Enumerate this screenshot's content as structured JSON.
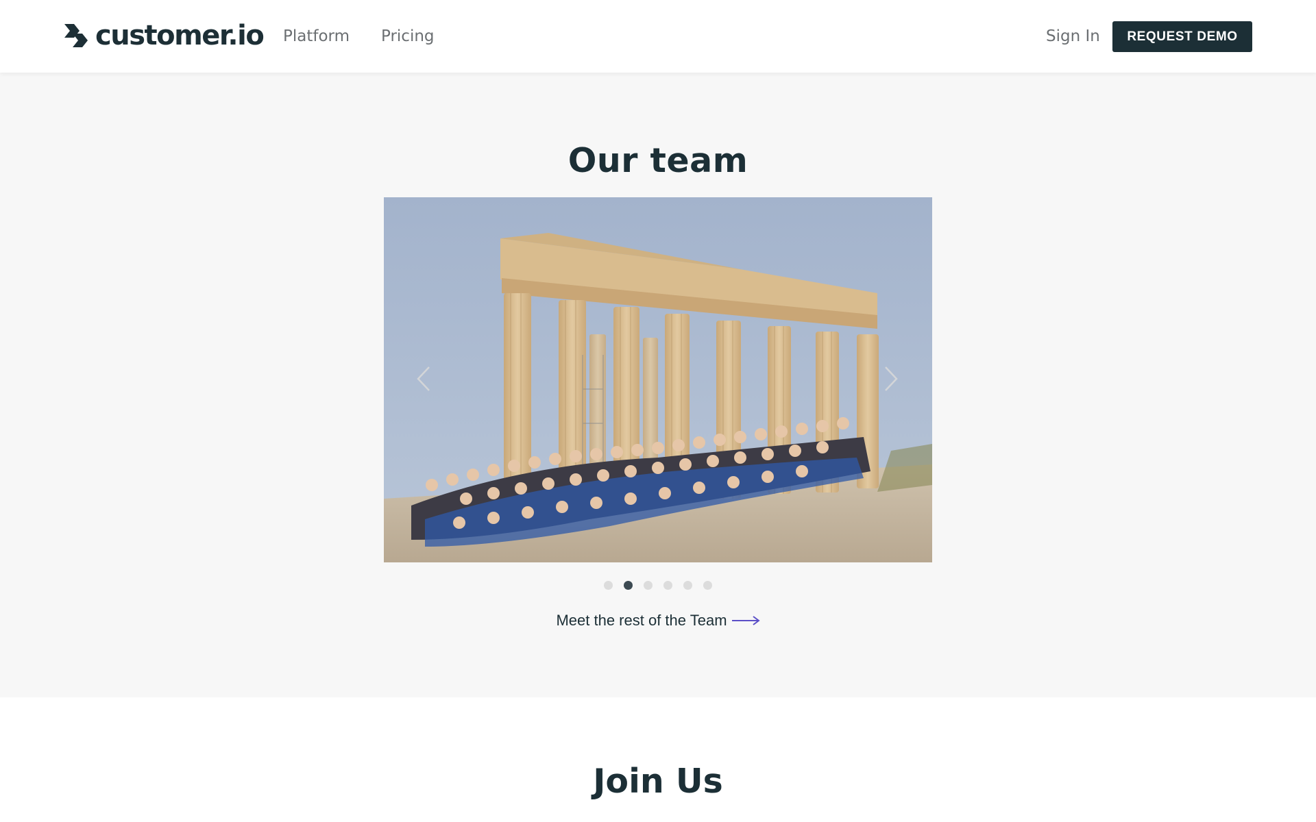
{
  "header": {
    "brand": "customer.io",
    "nav": [
      {
        "label": "Platform"
      },
      {
        "label": "Pricing"
      }
    ],
    "sign_in": "Sign In",
    "request_demo": "REQUEST DEMO"
  },
  "team": {
    "title": "Our team",
    "carousel": {
      "slide_count": 6,
      "active_index": 1
    },
    "meet_link": "Meet the rest of the Team"
  },
  "join": {
    "title": "Join Us"
  },
  "colors": {
    "brand_dark": "#1c2f36",
    "link_arrow": "#5b4fc7",
    "dot_active": "#3c4a52",
    "dot_inactive": "#dcdcdc",
    "page_bg": "#f7f7f7"
  }
}
